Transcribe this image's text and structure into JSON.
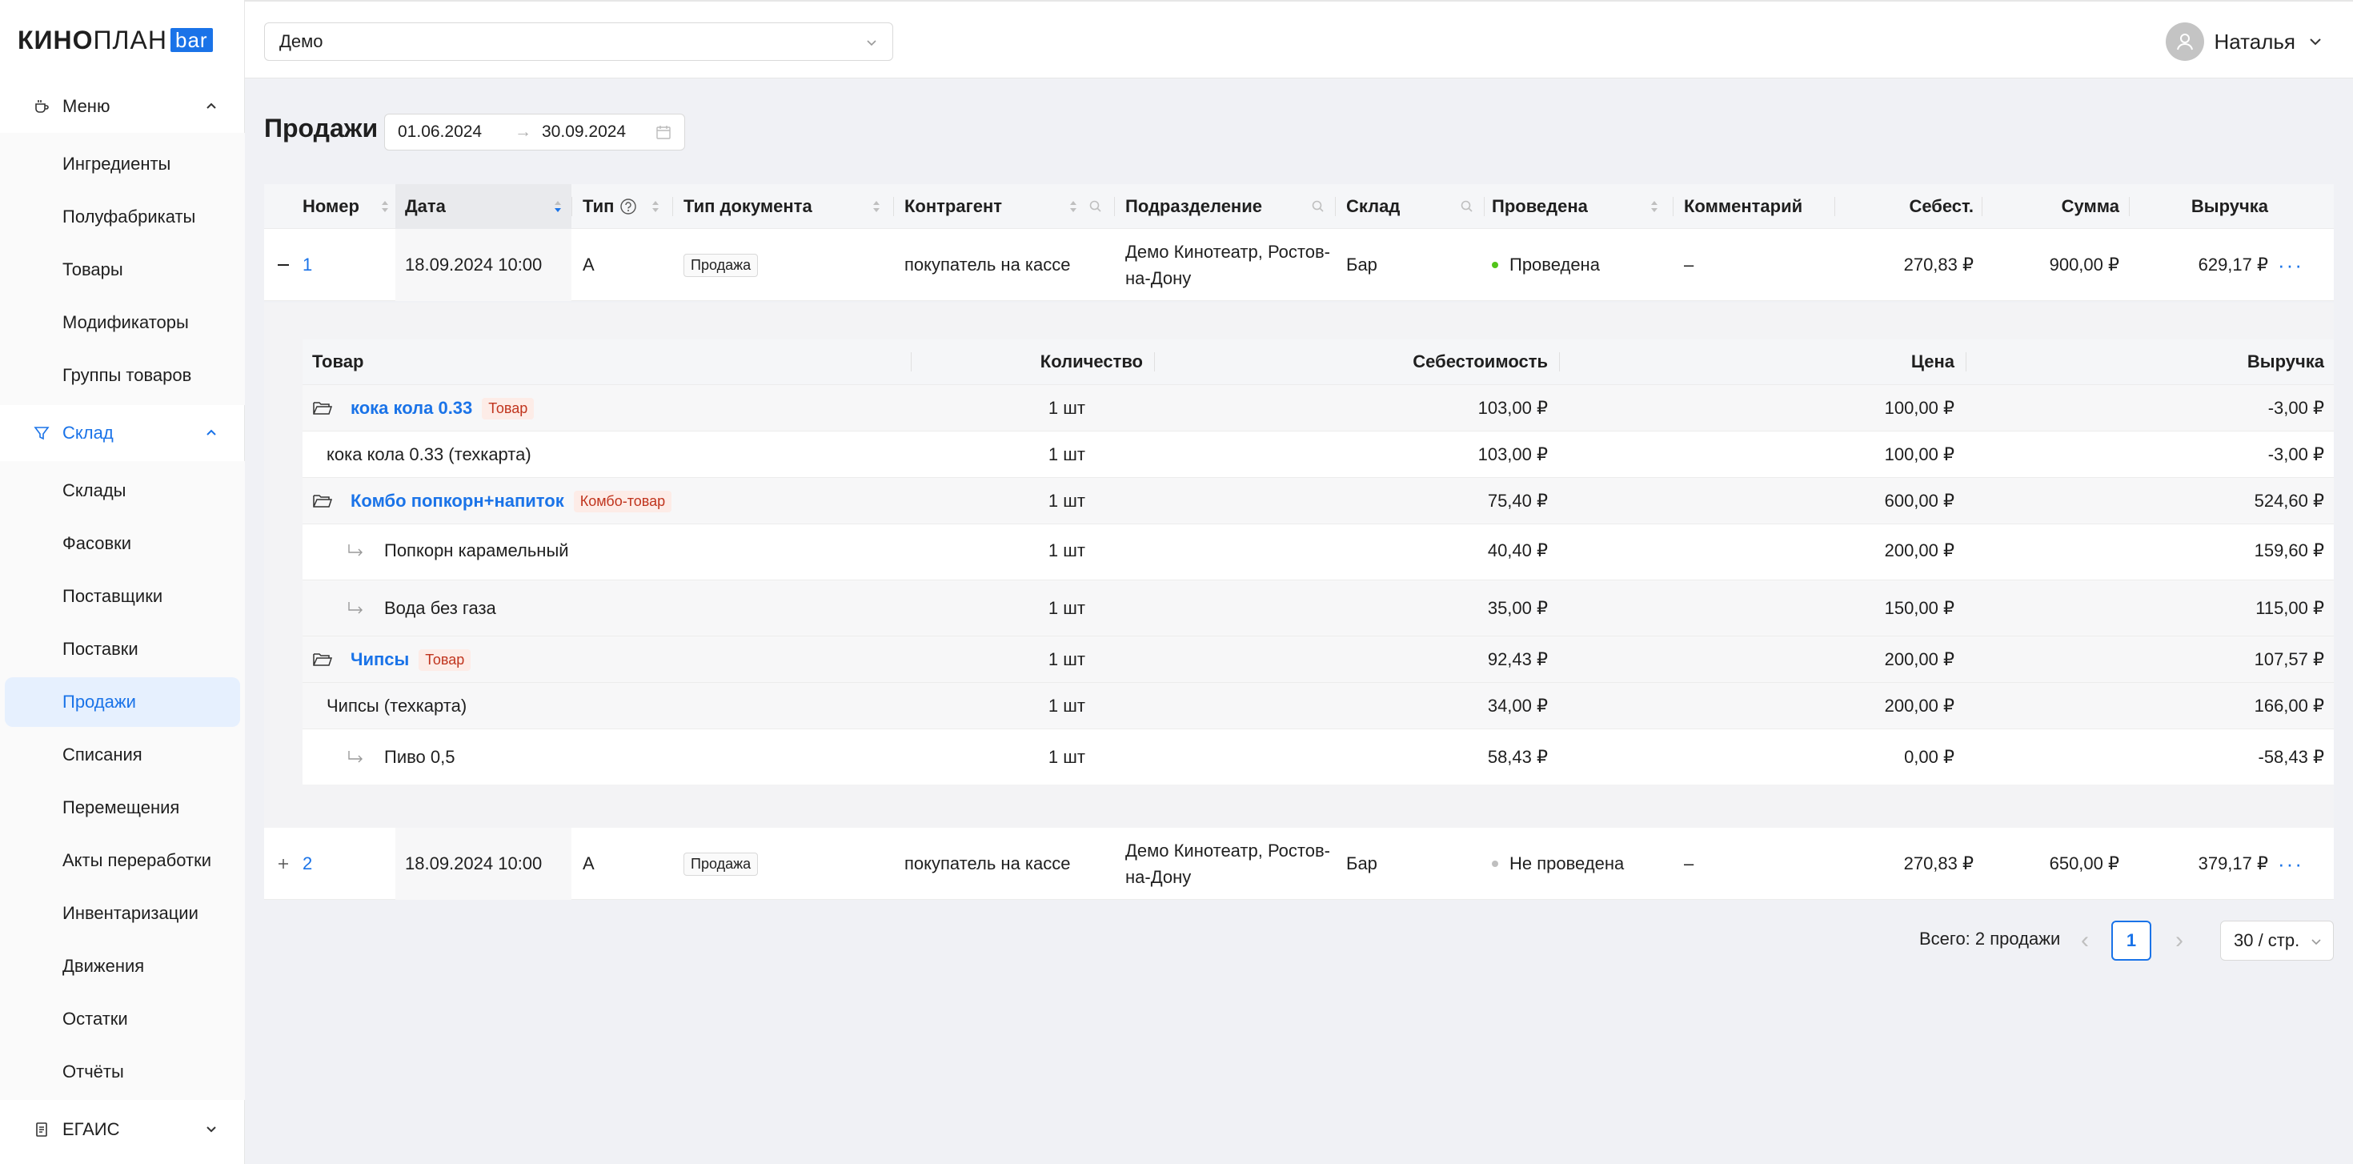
{
  "logo": {
    "part1": "КИНО",
    "part2": "ПЛАН",
    "part3": "bar"
  },
  "sidebar": {
    "menu_group": "Меню",
    "menu_items": [
      "Ингредиенты",
      "Полуфабрикаты",
      "Товары",
      "Модификаторы",
      "Группы товаров"
    ],
    "stock_group": "Склад",
    "stock_items": [
      "Склады",
      "Фасовки",
      "Поставщики",
      "Поставки",
      "Продажи",
      "Списания",
      "Перемещения",
      "Акты переработки",
      "Инвентаризации",
      "Движения",
      "Остатки",
      "Отчёты"
    ],
    "selected": "Продажи",
    "egais_group": "ЕГАИС"
  },
  "topbar": {
    "org_select": "Демо",
    "user_name": "Наталья"
  },
  "page": {
    "title": "Продажи",
    "date_from": "01.06.2024",
    "date_arrow": "→",
    "date_to": "30.09.2024"
  },
  "table": {
    "headers": {
      "number": "Номер",
      "date": "Дата",
      "type": "Тип",
      "doc_type": "Тип документа",
      "counterparty": "Контрагент",
      "division": "Подразделение",
      "stock": "Склад",
      "posted": "Проведена",
      "comment": "Комментарий",
      "cost": "Себест.",
      "sum": "Сумма",
      "revenue": "Выручка"
    },
    "rows": [
      {
        "expand": "−",
        "number": "1",
        "date": "18.09.2024 10:00",
        "type": "А",
        "doc_type": "Продажа",
        "counterparty": "покупатель на кассе",
        "division_line1": "Демо Кинотеатр, Ростов-",
        "division_line2": "на-Дону",
        "stock": "Бар",
        "posted": "Проведена",
        "comment": "–",
        "cost": "270,83 ₽",
        "sum": "900,00 ₽",
        "revenue": "629,17 ₽",
        "more": "···"
      },
      {
        "expand": "+",
        "number": "2",
        "date": "18.09.2024 10:00",
        "type": "А",
        "doc_type": "Продажа",
        "counterparty": "покупатель на кассе",
        "division_line1": "Демо Кинотеатр, Ростов-",
        "division_line2": "на-Дону",
        "stock": "Бар",
        "posted": "Не проведена",
        "comment": "–",
        "cost": "270,83 ₽",
        "sum": "650,00 ₽",
        "revenue": "379,17 ₽",
        "more": "···"
      }
    ],
    "status_colors": {
      "posted": "#52c41a",
      "not_posted": "#bfbfbf"
    }
  },
  "subtable": {
    "headers": {
      "product": "Товар",
      "qty": "Количество",
      "cost": "Себестоимость",
      "price": "Цена",
      "revenue": "Выручка"
    },
    "rows": [
      {
        "name": "кока кола 0.33",
        "badge": "Товар",
        "qty": "1 шт",
        "cost": "103,00 ₽",
        "price": "100,00 ₽",
        "revenue": "-3,00 ₽"
      },
      {
        "name": "кока кола 0.33 (техкарта)",
        "qty": "1 шт",
        "cost": "103,00 ₽",
        "price": "100,00 ₽",
        "revenue": "-3,00 ₽"
      },
      {
        "name": "Комбо попкорн+напиток",
        "badge": "Комбо-товар",
        "qty": "1 шт",
        "cost": "75,40 ₽",
        "price": "600,00 ₽",
        "revenue": "524,60 ₽"
      },
      {
        "name": "Попкорн карамельный",
        "qty": "1 шт",
        "cost": "40,40 ₽",
        "price": "200,00 ₽",
        "revenue": "159,60 ₽"
      },
      {
        "name": "Вода без газа",
        "qty": "1 шт",
        "cost": "35,00 ₽",
        "price": "150,00 ₽",
        "revenue": "115,00 ₽"
      },
      {
        "name": "Чипсы",
        "badge": "Товар",
        "qty": "1 шт",
        "cost": "92,43 ₽",
        "price": "200,00 ₽",
        "revenue": "107,57 ₽"
      },
      {
        "name": "Чипсы (техкарта)",
        "qty": "1 шт",
        "cost": "34,00 ₽",
        "price": "200,00 ₽",
        "revenue": "166,00 ₽"
      },
      {
        "name": "Пиво 0,5",
        "qty": "1 шт",
        "cost": "58,43 ₽",
        "price": "0,00 ₽",
        "revenue": "-58,43 ₽"
      }
    ]
  },
  "pagination": {
    "total": "Всего: 2 продажи",
    "prev": "‹",
    "current": "1",
    "next": "›",
    "page_size": "30 / стр."
  },
  "colors": {
    "accent": "#1a73e8",
    "badge_text": "#c0341d",
    "badge_bg": "#fdece7"
  }
}
